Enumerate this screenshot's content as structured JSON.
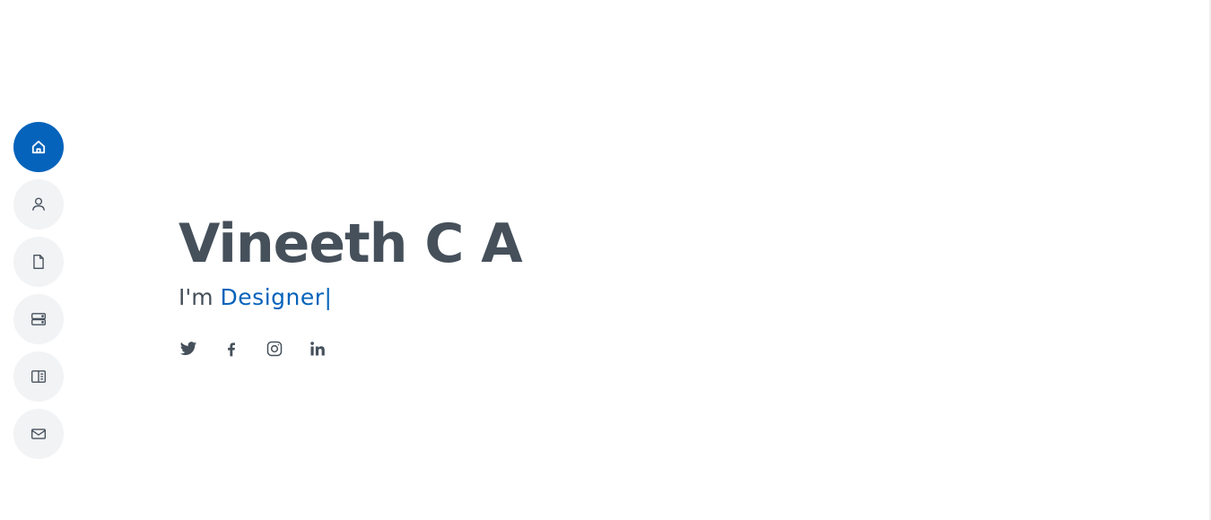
{
  "sidebar": {
    "items": [
      {
        "name": "home",
        "icon": "home-icon",
        "active": true
      },
      {
        "name": "about",
        "icon": "person-icon",
        "active": false
      },
      {
        "name": "resume",
        "icon": "file-icon",
        "active": false
      },
      {
        "name": "services",
        "icon": "server-icon",
        "active": false
      },
      {
        "name": "portfolio",
        "icon": "book-half-icon",
        "active": false
      },
      {
        "name": "contact",
        "icon": "envelope-icon",
        "active": false
      }
    ]
  },
  "hero": {
    "name": "Vineeth C A",
    "prefix": "I'm ",
    "typed": "Designer",
    "cursor": "|"
  },
  "socials": [
    {
      "name": "twitter",
      "icon": "twitter-icon"
    },
    {
      "name": "facebook",
      "icon": "facebook-icon"
    },
    {
      "name": "instagram",
      "icon": "instagram-icon"
    },
    {
      "name": "linkedin",
      "icon": "linkedin-icon"
    }
  ],
  "colors": {
    "accent": "#0563bb",
    "text": "#45505b",
    "nav_bg": "#f2f3f5",
    "background": "#ffffff"
  }
}
